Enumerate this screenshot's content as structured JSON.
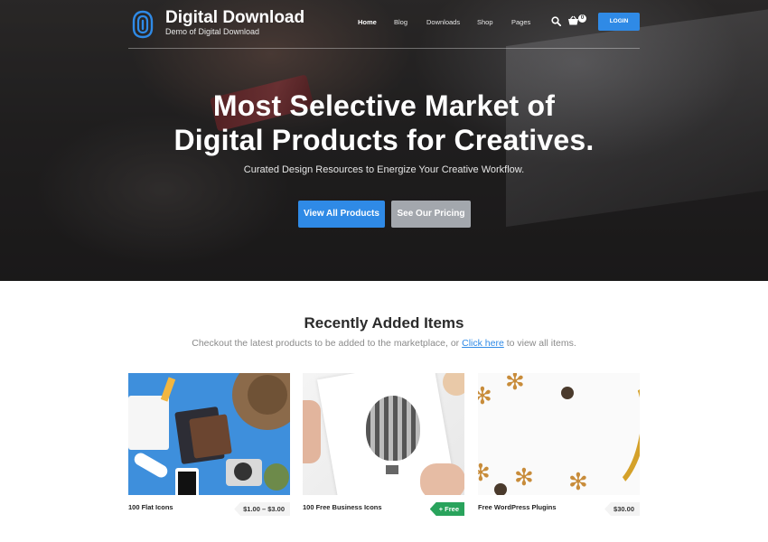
{
  "header": {
    "brand_name": "Digital Download",
    "brand_tagline": "Demo of Digital Download",
    "nav": [
      "Home",
      "Blog",
      "Downloads",
      "Shop",
      "Pages"
    ],
    "active_nav": "Home",
    "cart_count": "0",
    "login_label": "LOGIN",
    "accent_color": "#2f8ae6"
  },
  "hero": {
    "title_line1": "Most Selective Market of",
    "title_line2": "Digital Products for Creatives.",
    "subtitle": "Curated Design Resources to Energize Your Creative Workflow.",
    "primary_button": "View All Products",
    "secondary_button": "See Our Pricing"
  },
  "recent": {
    "title": "Recently Added Items",
    "subtitle_before": "Checkout the latest products to be added to the marketplace, or ",
    "subtitle_link": "Click here",
    "subtitle_after": " to view all items.",
    "items": [
      {
        "title": "100 Flat Icons",
        "price": "$1.00 – $3.00",
        "free": false
      },
      {
        "title": "100 Free Business Icons",
        "price": "+ Free",
        "free": true
      },
      {
        "title": "Free WordPress Plugins",
        "price": "$30.00",
        "free": false
      }
    ]
  },
  "icons": [
    "logo-icon",
    "search-icon",
    "cart-icon"
  ]
}
